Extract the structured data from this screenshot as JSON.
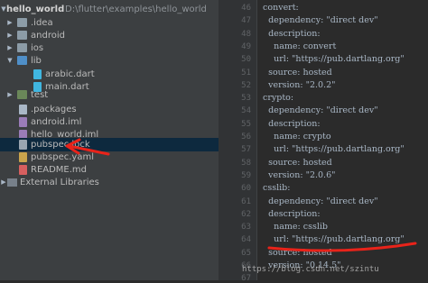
{
  "tree": {
    "root_label": "hello_world",
    "root_path": "D:\\flutter\\examples\\hello_world",
    "items": [
      {
        "label": ".idea"
      },
      {
        "label": "android"
      },
      {
        "label": "ios"
      },
      {
        "label": "lib"
      },
      {
        "label": "arabic.dart"
      },
      {
        "label": "main.dart"
      },
      {
        "label": "test"
      },
      {
        "label": ".packages"
      },
      {
        "label": "android.iml"
      },
      {
        "label": "hello_world.iml"
      },
      {
        "label": "pubspec.lock"
      },
      {
        "label": "pubspec.yaml"
      },
      {
        "label": "README.md"
      },
      {
        "label": "External Libraries"
      }
    ]
  },
  "editor": {
    "line_numbers": [
      "46",
      "47",
      "48",
      "49",
      "50",
      "51",
      "52",
      "53",
      "54",
      "55",
      "56",
      "57",
      "58",
      "59",
      "60",
      "61",
      "62",
      "63",
      "64",
      "65",
      "66",
      "67"
    ],
    "lines": [
      "  convert:",
      "    dependency: \"direct dev\"",
      "    description:",
      "      name: convert",
      "      url: \"https://pub.dartlang.org\"",
      "    source: hosted",
      "    version: \"2.0.2\"",
      "  crypto:",
      "    dependency: \"direct dev\"",
      "    description:",
      "      name: crypto",
      "      url: \"https://pub.dartlang.org\"",
      "    source: hosted",
      "    version: \"2.0.6\"",
      "  csslib:",
      "    dependency: \"direct dev\"",
      "    description:",
      "      name: csslib",
      "      url: \"https://pub.dartlang.org\"",
      "    source: hosted",
      "    version: \"0.14.5\""
    ]
  },
  "watermark": "https://blog.csdn.net/szintu",
  "colors": {
    "tree_bg": "#3c3f41",
    "editor_bg": "#2b2b2b",
    "selection": "#0d293e",
    "annotation_red": "#e8231a"
  }
}
